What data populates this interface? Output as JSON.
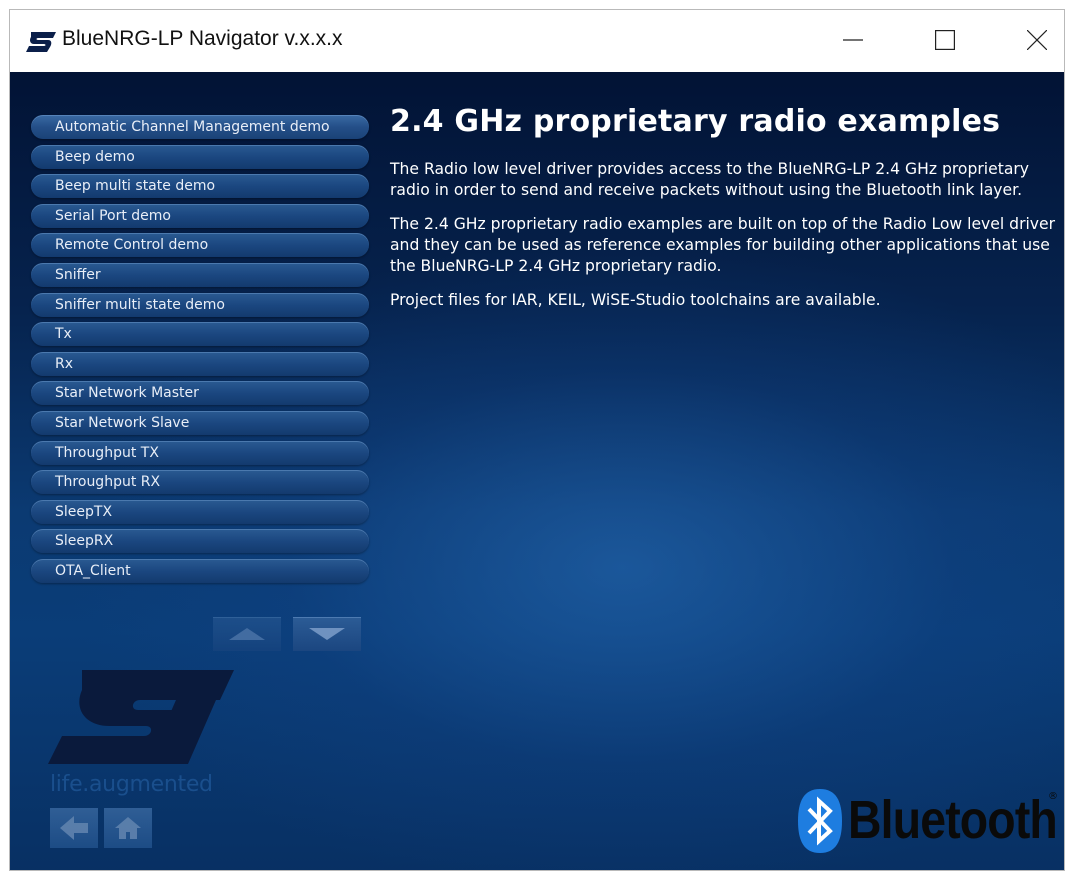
{
  "window": {
    "title": "BlueNRG-LP Navigator v.x.x.x",
    "controls": [
      "minimize",
      "maximize",
      "close"
    ]
  },
  "sidebar": {
    "items": [
      {
        "label": "Automatic Channel Management demo"
      },
      {
        "label": "Beep demo"
      },
      {
        "label": "Beep multi state demo"
      },
      {
        "label": "Serial Port demo"
      },
      {
        "label": "Remote Control demo"
      },
      {
        "label": "Sniffer"
      },
      {
        "label": "Sniffer multi state demo"
      },
      {
        "label": "Tx"
      },
      {
        "label": "Rx"
      },
      {
        "label": "Star Network Master"
      },
      {
        "label": "Star Network Slave"
      },
      {
        "label": "Throughput TX"
      },
      {
        "label": "Throughput RX"
      },
      {
        "label": "SleepTX"
      },
      {
        "label": "SleepRX"
      },
      {
        "label": "OTA_Client"
      }
    ],
    "scroll_up_icon": "triangle-up-icon",
    "scroll_down_icon": "triangle-down-icon"
  },
  "main": {
    "heading": "2.4 GHz proprietary radio examples",
    "paragraphs": [
      "The Radio low level driver provides access to the BlueNRG-LP 2.4 GHz proprietary radio in order to send and receive packets without using the Bluetooth link layer.",
      "The 2.4 GHz proprietary radio examples are built on top of the Radio Low level driver and they can be used as reference examples for building other applications that use the BlueNRG-LP 2.4 GHz proprietary radio.",
      "Project files for IAR, KEIL, WiSE-Studio toolchains are available."
    ]
  },
  "branding": {
    "company_logo": "st-logo",
    "tagline": "life.augmented",
    "bluetooth_text": "Bluetooth",
    "bluetooth_reg": "®"
  },
  "footer": {
    "back_icon": "arrow-left-icon",
    "home_icon": "home-icon"
  },
  "colors": {
    "background_top": "#021335",
    "background_mid": "#0b3a72",
    "nav_item": "#1b4780",
    "heading": "#ffffff",
    "tagline": "#1a4f8d",
    "bluetooth_badge": "#1e7de0"
  }
}
